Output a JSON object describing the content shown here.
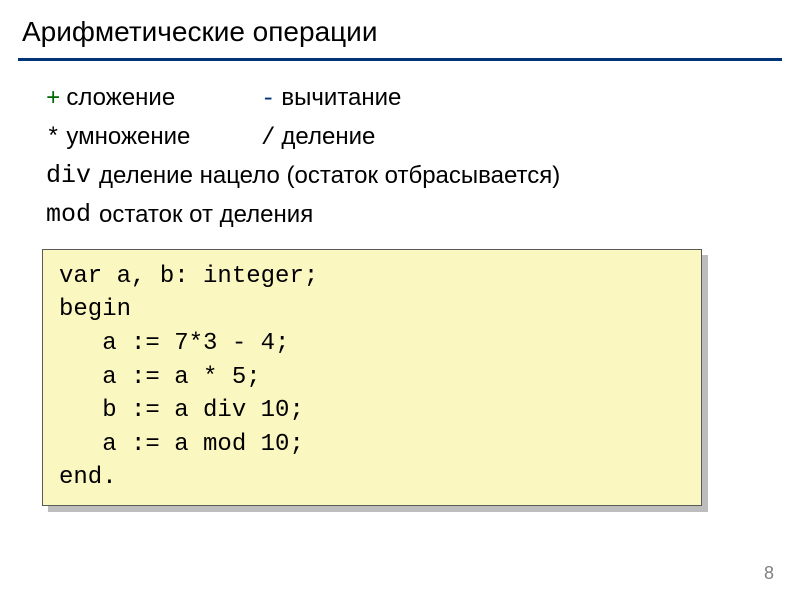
{
  "title": "Арифметические операции",
  "ops": {
    "plus_sym": "+",
    "plus_label": "сложение",
    "minus_sym": "-",
    "minus_label": "вычитание",
    "mul_sym": "*",
    "mul_label": "умножение",
    "div_sym": "/",
    "div_label": "деление",
    "divkw": "div",
    "divkw_label": "деление нацело (остаток отбрасывается)",
    "modkw": "mod",
    "modkw_label": "остаток от деления"
  },
  "code": "var a, b: integer;\nbegin\n   a := 7*3 - 4;\n   a := a * 5;\n   b := a div 10;\n   a := a mod 10;\nend.",
  "page_number": "8"
}
